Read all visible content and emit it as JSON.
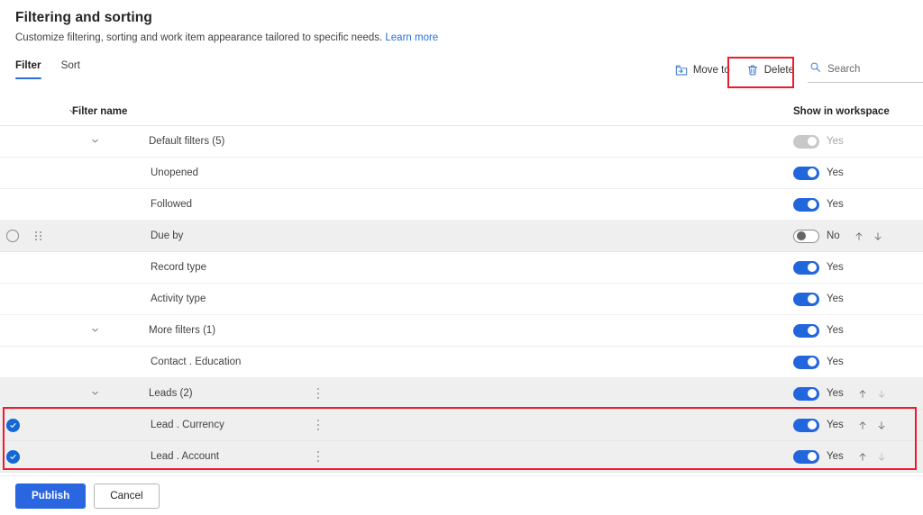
{
  "header": {
    "title": "Filtering and sorting",
    "subtitle": "Customize filtering, sorting and work item appearance tailored to specific needs.",
    "learn_more": "Learn more"
  },
  "tabs": [
    {
      "label": "Filter",
      "active": true
    },
    {
      "label": "Sort",
      "active": false
    }
  ],
  "commands": {
    "move_to": "Move to",
    "delete": "Delete",
    "search_placeholder": "Search"
  },
  "table": {
    "col_name": "Filter name",
    "col_workspace": "Show in workspace",
    "rows": [
      {
        "name": "Default filters (5)",
        "indent": "group",
        "chevron": true,
        "shaded": false,
        "checkbox": "none",
        "drag": false,
        "ellipsis": false,
        "toggle": "disabled-on",
        "toggle_label": "Yes",
        "toggle_label_dim": true,
        "arrows": "none"
      },
      {
        "name": "Unopened",
        "indent": "leaf",
        "chevron": false,
        "shaded": false,
        "checkbox": "none",
        "drag": false,
        "ellipsis": false,
        "toggle": "on",
        "toggle_label": "Yes",
        "toggle_label_dim": false,
        "arrows": "none"
      },
      {
        "name": "Followed",
        "indent": "leaf",
        "chevron": false,
        "shaded": false,
        "checkbox": "none",
        "drag": false,
        "ellipsis": false,
        "toggle": "on",
        "toggle_label": "Yes",
        "toggle_label_dim": false,
        "arrows": "none"
      },
      {
        "name": "Due by",
        "indent": "leaf",
        "chevron": false,
        "shaded": true,
        "checkbox": "unchecked",
        "drag": true,
        "ellipsis": false,
        "toggle": "off",
        "toggle_label": "No",
        "toggle_label_dim": false,
        "arrows": "both"
      },
      {
        "name": "Record type",
        "indent": "leaf",
        "chevron": false,
        "shaded": false,
        "checkbox": "none",
        "drag": false,
        "ellipsis": false,
        "toggle": "on",
        "toggle_label": "Yes",
        "toggle_label_dim": false,
        "arrows": "none"
      },
      {
        "name": "Activity type",
        "indent": "leaf",
        "chevron": false,
        "shaded": false,
        "checkbox": "none",
        "drag": false,
        "ellipsis": false,
        "toggle": "on",
        "toggle_label": "Yes",
        "toggle_label_dim": false,
        "arrows": "none"
      },
      {
        "name": "More filters (1)",
        "indent": "group",
        "chevron": true,
        "shaded": false,
        "checkbox": "none",
        "drag": false,
        "ellipsis": false,
        "toggle": "on",
        "toggle_label": "Yes",
        "toggle_label_dim": false,
        "arrows": "none"
      },
      {
        "name": "Contact . Education",
        "indent": "leaf",
        "chevron": false,
        "shaded": false,
        "checkbox": "none",
        "drag": false,
        "ellipsis": false,
        "toggle": "on",
        "toggle_label": "Yes",
        "toggle_label_dim": false,
        "arrows": "none"
      },
      {
        "name": "Leads (2)",
        "indent": "group",
        "chevron": true,
        "shaded": true,
        "checkbox": "none",
        "drag": false,
        "ellipsis": true,
        "toggle": "on",
        "toggle_label": "Yes",
        "toggle_label_dim": false,
        "arrows": "up-strong-down-weak"
      },
      {
        "name": "Lead . Currency",
        "indent": "leaf",
        "chevron": false,
        "shaded": true,
        "checkbox": "checked",
        "drag": false,
        "ellipsis": true,
        "toggle": "on",
        "toggle_label": "Yes",
        "toggle_label_dim": false,
        "arrows": "both"
      },
      {
        "name": "Lead . Account",
        "indent": "leaf",
        "chevron": false,
        "shaded": true,
        "checkbox": "checked",
        "drag": false,
        "ellipsis": true,
        "toggle": "on",
        "toggle_label": "Yes",
        "toggle_label_dim": false,
        "arrows": "up-strong-down-weak"
      }
    ]
  },
  "footer": {
    "publish": "Publish",
    "cancel": "Cancel"
  },
  "colors": {
    "accent_blue": "#2a6fd4",
    "toggle_on": "#2266dd",
    "primary_button": "#2a66e0",
    "annotation_red": "#ee1b2e",
    "checkbox_checked": "#1268d4"
  }
}
